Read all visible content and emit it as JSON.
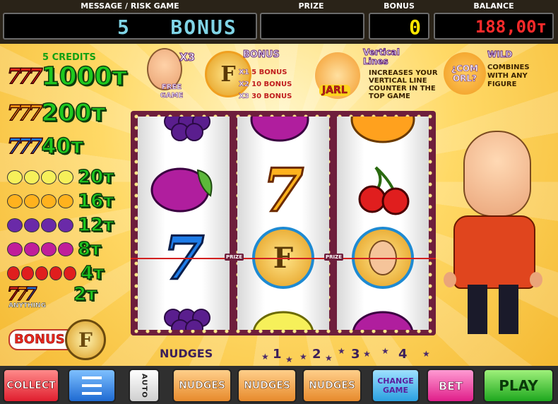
{
  "topbar": {
    "message_label": "MESSAGE / RISK GAME",
    "message_value": "5   BONUS",
    "prize_label": "PRIZE",
    "prize_value": "",
    "bonus_label": "BONUS",
    "bonus_value": "0",
    "balance_label": "BALANCE",
    "balance_value": "188,00т"
  },
  "paytable": {
    "credits_header": "5 CREDITS",
    "rows": [
      {
        "symbol": "red-seven",
        "value": "1000т"
      },
      {
        "symbol": "orange-seven",
        "value": "200т"
      },
      {
        "symbol": "blue-seven",
        "value": "40т"
      },
      {
        "symbol": "lemon",
        "value": "20т"
      },
      {
        "symbol": "orange",
        "value": "16т"
      },
      {
        "symbol": "grapes",
        "value": "12т"
      },
      {
        "symbol": "plum",
        "value": "8т"
      },
      {
        "symbol": "cherry",
        "value": "4т"
      },
      {
        "symbol": "any-seven",
        "value": "2т"
      }
    ],
    "anything_label": "ANYTHING",
    "bonus_label": "BONUS"
  },
  "info": {
    "free_game_multiplier": "X3",
    "free_game_label": "FREE GAME",
    "bonus_title": "BONUS",
    "bonus_lines": [
      {
        "mult": "X1",
        "text": "5 BONUS"
      },
      {
        "mult": "X2",
        "text": "10 BONUS"
      },
      {
        "mult": "X3",
        "text": "30 BONUS"
      }
    ],
    "jarl_label": "JARL",
    "vertical_title": "Vertical Lines",
    "vertical_text": "INCREASES YOUR VERTICAL LINE COUNTER IN THE TOP GAME",
    "wild_badge": "¿COM ORL?",
    "wild_title": "WILD",
    "wild_text": "COMBINES WITH ANY FIGURE"
  },
  "reels": {
    "prize_tag": "PRIZE",
    "reel1": [
      "grapes",
      "plum",
      "blue-seven",
      "grapes"
    ],
    "reel2": [
      "plum",
      "orange-seven",
      "bonus-f",
      "lemon"
    ],
    "reel3": [
      "orange",
      "cherry",
      "character",
      "plum"
    ]
  },
  "nudges": {
    "label": "NUDGES",
    "numbers": [
      "1",
      "2",
      "3",
      "4"
    ]
  },
  "buttons": {
    "collect": "COLLECT",
    "auto": "AUTO",
    "nudges1": "NUDGES",
    "nudges2": "NUDGES",
    "nudges3": "NUDGES",
    "change_game": "CHANGE GAME",
    "bet": "BET",
    "play": "PLAY"
  },
  "colors": {
    "message_text": "#7fd4e6",
    "bonus_text": "#ffe600",
    "balance_text": "#ff2a2a",
    "paytable_green": "#1ec81e",
    "frame": "#6e1e3c"
  }
}
